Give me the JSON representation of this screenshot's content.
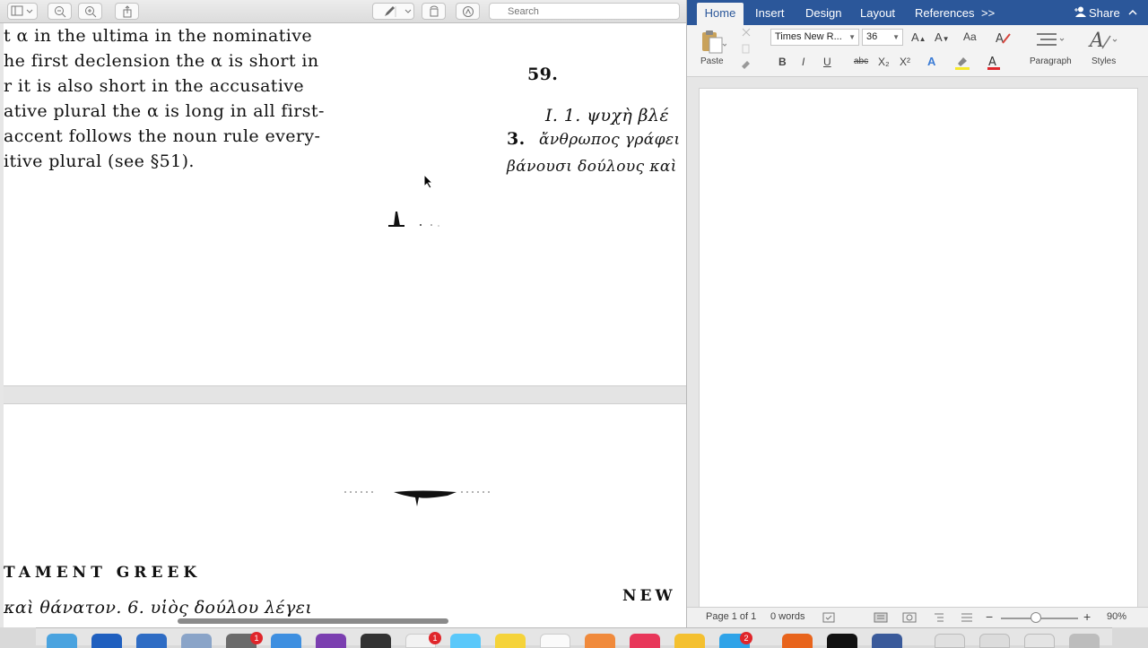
{
  "preview": {
    "search_placeholder": "Search",
    "page1": {
      "left_lines": [
        "t α in the ultima in the nominative",
        "he first declension the α is short in",
        "r it is also short in the accusative",
        "ative plural the α is long in all first-",
        "accent follows the noun rule every-",
        "itive plural (see §51)."
      ],
      "section_number": "59.",
      "exercise_line1": "I.   1. ψυχὴ βλέ",
      "exercise_line2_num": "3.",
      "exercise_line2": "ἄνθρωπος γράφει",
      "exercise_line3": "βάνουσι δούλους καὶ"
    },
    "page2": {
      "running_head": "TAMENT GREEK",
      "running_head_right": "NEW",
      "bottom_line": "καὶ θάνατον.   6. υἱὸς δούλου λέγει"
    }
  },
  "word": {
    "tabs": {
      "home": "Home",
      "insert": "Insert",
      "design": "Design",
      "layout": "Layout",
      "references": "References",
      "more": ">>",
      "share": "Share"
    },
    "ribbon": {
      "paste": "Paste",
      "font_name": "Times New R...",
      "font_size": "36",
      "paragraph": "Paragraph",
      "styles": "Styles",
      "bold": "B",
      "italic": "I",
      "underline": "U",
      "strike": "abc",
      "subscript": "X₂",
      "superscript": "X²"
    },
    "status": {
      "page": "Page 1 of 1",
      "words": "0 words",
      "zoom": "90%"
    }
  },
  "dock": {
    "badges": [
      "1",
      "1",
      "2"
    ]
  }
}
